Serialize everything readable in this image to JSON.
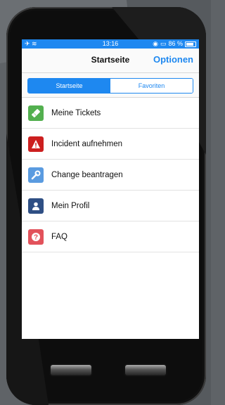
{
  "status": {
    "time": "13:16",
    "battery_text": "86 %",
    "battery_level": 0.86
  },
  "nav": {
    "title": "Startseite",
    "options_label": "Optionen"
  },
  "tabs": [
    {
      "label": "Startseite",
      "active": true
    },
    {
      "label": "Favoriten",
      "active": false
    }
  ],
  "menu": [
    {
      "label": "Meine Tickets",
      "icon": "ticket-icon",
      "color": "#53b04f"
    },
    {
      "label": "Incident aufnehmen",
      "icon": "warning-icon",
      "color": "#cc1f1f"
    },
    {
      "label": "Change beantragen",
      "icon": "wrench-icon",
      "color": "#5a9be0"
    },
    {
      "label": "Mein Profil",
      "icon": "person-icon",
      "color": "#2f4f84"
    },
    {
      "label": "FAQ",
      "icon": "question-icon",
      "color": "#e2525b"
    }
  ],
  "colors": {
    "accent": "#1e88f0",
    "background": "#5f6367"
  }
}
